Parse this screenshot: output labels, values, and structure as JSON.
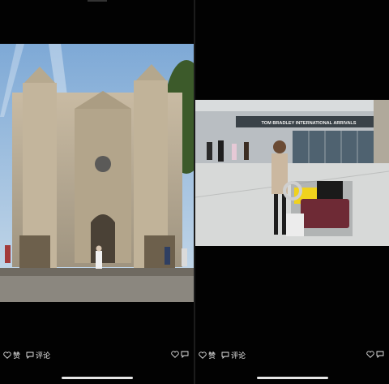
{
  "left_post": {
    "photo_name": "cathedral-facade-photo",
    "like_label": "赞",
    "comment_label": "评论"
  },
  "right_post": {
    "photo_name": "airport-arrivals-photo",
    "sign_text": "TOM BRADLEY INTERNATIONAL ARRIVALS",
    "like_label": "赞",
    "comment_label": "评论"
  }
}
